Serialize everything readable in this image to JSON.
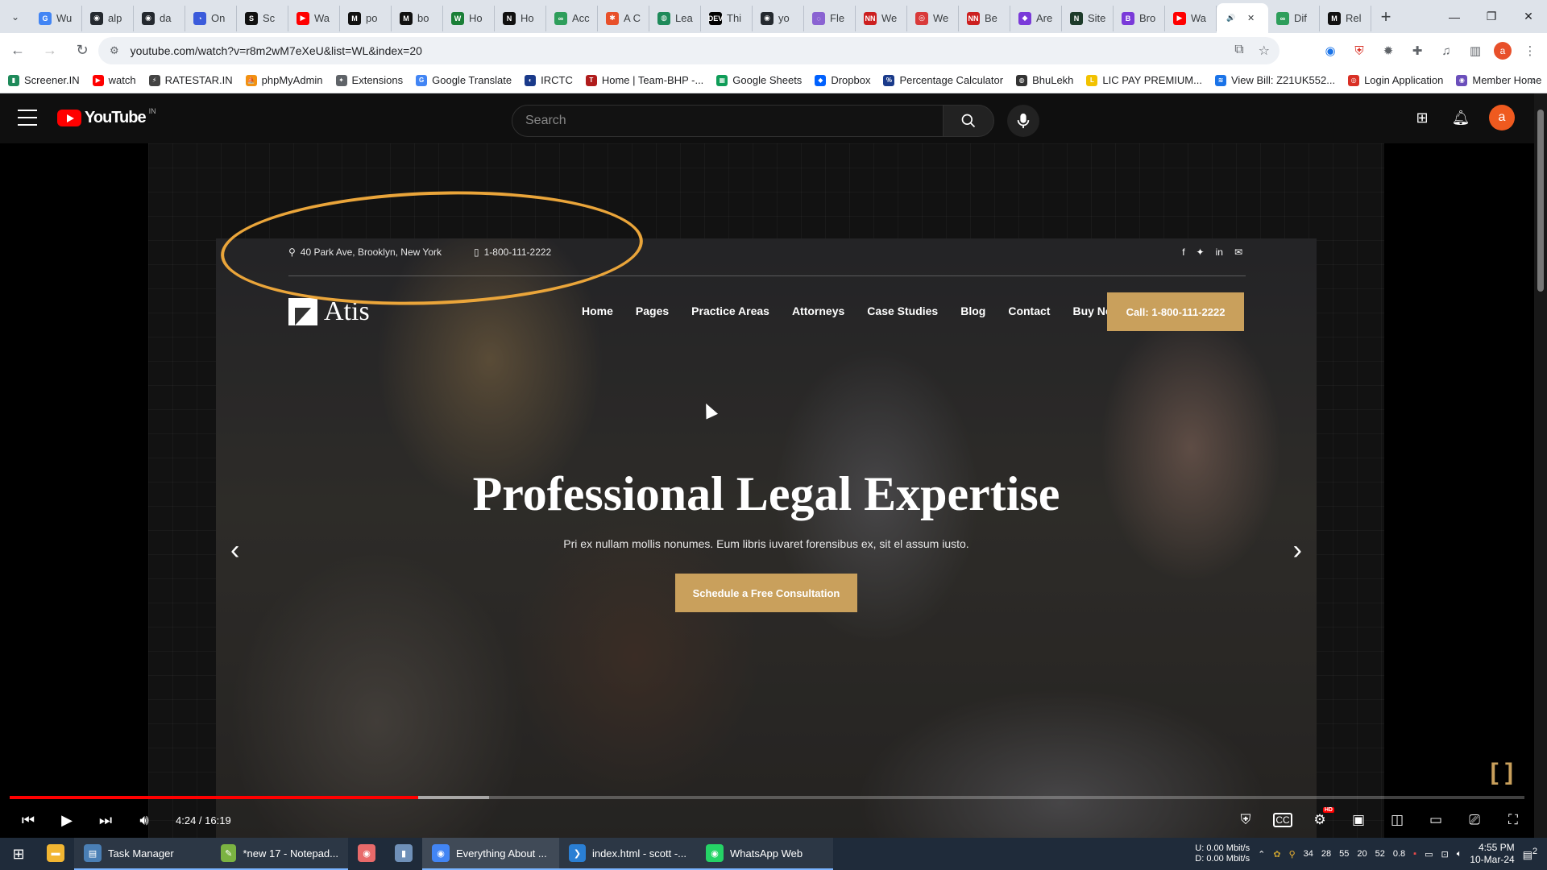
{
  "browser": {
    "tabs": [
      {
        "label": "Wu",
        "color": "#4285f4",
        "glyph": "G"
      },
      {
        "label": "alp",
        "color": "#24292f",
        "glyph": "◉"
      },
      {
        "label": "da",
        "color": "#24292f",
        "glyph": "◉"
      },
      {
        "label": "On",
        "color": "#3b5bdb",
        "glyph": "◔"
      },
      {
        "label": "Sc",
        "color": "#111111",
        "glyph": "S"
      },
      {
        "label": "Wa",
        "color": "#ff0000",
        "glyph": "▶"
      },
      {
        "label": "po",
        "color": "#111111",
        "glyph": "M"
      },
      {
        "label": "bo",
        "color": "#111111",
        "glyph": "M"
      },
      {
        "label": "Ho",
        "color": "#1a7f37",
        "glyph": "W"
      },
      {
        "label": "Ho",
        "color": "#111111",
        "glyph": "N"
      },
      {
        "label": "Acc",
        "color": "#2e9e5b",
        "glyph": "∞"
      },
      {
        "label": "A C",
        "color": "#e8502a",
        "glyph": "✱"
      },
      {
        "label": "Lea",
        "color": "#1e8a5a",
        "glyph": "◍"
      },
      {
        "label": "Thi",
        "color": "#000000",
        "glyph": "DEV"
      },
      {
        "label": "yo",
        "color": "#24292f",
        "glyph": "◉"
      },
      {
        "label": "Fle",
        "color": "#8a63d2",
        "glyph": "◌"
      },
      {
        "label": "We",
        "color": "#cc1f1f",
        "glyph": "NN"
      },
      {
        "label": "We",
        "color": "#d93a3a",
        "glyph": "◎"
      },
      {
        "label": "Be",
        "color": "#cc1f1f",
        "glyph": "NN"
      },
      {
        "label": "Are",
        "color": "#7a3ad9",
        "glyph": "◆"
      },
      {
        "label": "Site",
        "color": "#1d3b2a",
        "glyph": "N"
      },
      {
        "label": "Bro",
        "color": "#7a3ad9",
        "glyph": "B"
      },
      {
        "label": "Wa",
        "color": "#ff0000",
        "glyph": "▶"
      },
      {
        "label": "",
        "color": "#ffffff",
        "glyph": "🔊",
        "active": true
      },
      {
        "label": "Dif",
        "color": "#2e9e5b",
        "glyph": "∞"
      },
      {
        "label": "Rel",
        "color": "#111111",
        "glyph": "M"
      }
    ],
    "url": "youtube.com/watch?v=r8m2wM7eXeU&list=WL&index=20",
    "bookmarks": [
      {
        "label": "Screener.IN",
        "color": "#1e8a5a",
        "glyph": "▮"
      },
      {
        "label": "watch",
        "color": "#ff0000",
        "glyph": "▶"
      },
      {
        "label": "RATESTAR.IN",
        "color": "#444444",
        "glyph": "⚡"
      },
      {
        "label": "phpMyAdmin",
        "color": "#f29111",
        "glyph": "⛵"
      },
      {
        "label": "Extensions",
        "color": "#5f6368",
        "glyph": "✦"
      },
      {
        "label": "Google Translate",
        "color": "#4285f4",
        "glyph": "G"
      },
      {
        "label": "IRCTC",
        "color": "#1a3a8a",
        "glyph": "◐"
      },
      {
        "label": "Home | Team-BHP -...",
        "color": "#b01c1c",
        "glyph": "T"
      },
      {
        "label": "Google Sheets",
        "color": "#0f9d58",
        "glyph": "▦"
      },
      {
        "label": "Dropbox",
        "color": "#0061fe",
        "glyph": "◆"
      },
      {
        "label": "Percentage Calculator",
        "color": "#1a3a8a",
        "glyph": "%"
      },
      {
        "label": "BhuLekh",
        "color": "#333333",
        "glyph": "◍"
      },
      {
        "label": "LIC PAY PREMIUM...",
        "color": "#f2c200",
        "glyph": "L"
      },
      {
        "label": "View Bill: Z21UK552...",
        "color": "#1a73e8",
        "glyph": "≋"
      },
      {
        "label": "Login Application",
        "color": "#d93025",
        "glyph": "◎"
      },
      {
        "label": "Member Home",
        "color": "#6b4fbb",
        "glyph": "◉"
      }
    ]
  },
  "youtube": {
    "logo_text": "YouTube",
    "country_code": "IN",
    "search_placeholder": "Search",
    "avatar_letter": "a"
  },
  "video_site": {
    "address": "40 Park Ave, Brooklyn, New York",
    "phone": "1-800-111-2222",
    "logo_name": "Atis",
    "nav": [
      "Home",
      "Pages",
      "Practice Areas",
      "Attorneys",
      "Case Studies",
      "Blog",
      "Contact",
      "Buy Now"
    ],
    "cta": "Call: 1-800-111-2222",
    "hero_title": "Professional Legal Expertise",
    "hero_subtitle": "Pri ex nullam mollis nonumes. Eum libris iuvaret forensibus ex, sit el assum iusto.",
    "hero_button": "Schedule a Free Consultation",
    "annotation_color": "#eaa53a",
    "accent_color": "#c9a05c"
  },
  "player": {
    "time_display": "4:24 / 16:19",
    "progress_fraction": 0.2697,
    "buffered_fraction": 0.3167,
    "progress_color": "#ff0000",
    "hd_label": "HD"
  },
  "taskbar": {
    "items": [
      {
        "label": "Task Manager",
        "color": "#4a7fb5",
        "glyph": "▤",
        "state": "open"
      },
      {
        "label": "*new 17 - Notepad...",
        "color": "#7bb342",
        "glyph": "✎",
        "state": "open"
      },
      {
        "label": "",
        "color": "#e86a6a",
        "glyph": "◉",
        "state": "none"
      },
      {
        "label": "",
        "color": "#6f90b8",
        "glyph": "▮",
        "state": "none"
      },
      {
        "label": "Everything About ...",
        "color": "#4285f4",
        "glyph": "◉",
        "state": "active"
      },
      {
        "label": "index.html - scott -...",
        "color": "#2a7fd4",
        "glyph": "❯",
        "state": "open"
      },
      {
        "label": "WhatsApp Web",
        "color": "#25d366",
        "glyph": "◉",
        "state": "open"
      }
    ],
    "net_up_label": "U:",
    "net_down_label": "D:",
    "net_up": "0.00 Mbit/s",
    "net_down": "0.00 Mbit/s",
    "tray_numbers": [
      "34",
      "28",
      "55",
      "20",
      "52",
      "0.8"
    ],
    "time": "4:55 PM",
    "date": "10-Mar-24",
    "notifications": "2"
  }
}
